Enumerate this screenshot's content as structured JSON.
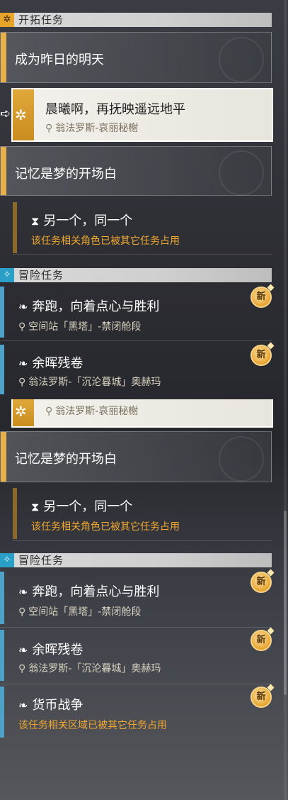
{
  "sections": {
    "trailblaze": {
      "icon": "trailblaze-icon",
      "label": "开拓任务"
    },
    "adventure": {
      "icon": "adventure-icon",
      "label": "冒险任务"
    }
  },
  "top": {
    "q1": {
      "title": "成为昨日的明天"
    },
    "q2": {
      "title": "晨曦啊，再抚映遥远地平",
      "location": "翁法罗斯-哀丽秘榭"
    },
    "q3": {
      "title": "记忆是梦的开场白"
    },
    "q4": {
      "title": "另一个，同一个",
      "status": "该任务相关角色已被其它任务占用"
    },
    "a1": {
      "title": "奔跑，向着点心与胜利",
      "location": "空间站「黑塔」-禁闭舱段",
      "badge": "新"
    },
    "a2": {
      "title": "余晖残卷",
      "location": "翁法罗斯-「沉沦暮城」奥赫玛",
      "badge": "新"
    }
  },
  "bottom": {
    "q2": {
      "location": "翁法罗斯-哀丽秘榭"
    },
    "q3": {
      "title": "记忆是梦的开场白"
    },
    "q4": {
      "title": "另一个，同一个",
      "status": "该任务相关角色已被其它任务占用"
    },
    "a1": {
      "title": "奔跑，向着点心与胜利",
      "location": "空间站「黑塔」-禁闭舱段",
      "badge": "新"
    },
    "a2": {
      "title": "余晖残卷",
      "location": "翁法罗斯-「沉沦暮城」奥赫玛",
      "badge": "新"
    },
    "a3": {
      "title": "货币战争",
      "status": "该任务相关区域已被其它任务占用",
      "badge": "新"
    }
  },
  "colors": {
    "gold": "#e7b04a",
    "blue": "#4fa2c7",
    "orange": "#f0a830"
  }
}
